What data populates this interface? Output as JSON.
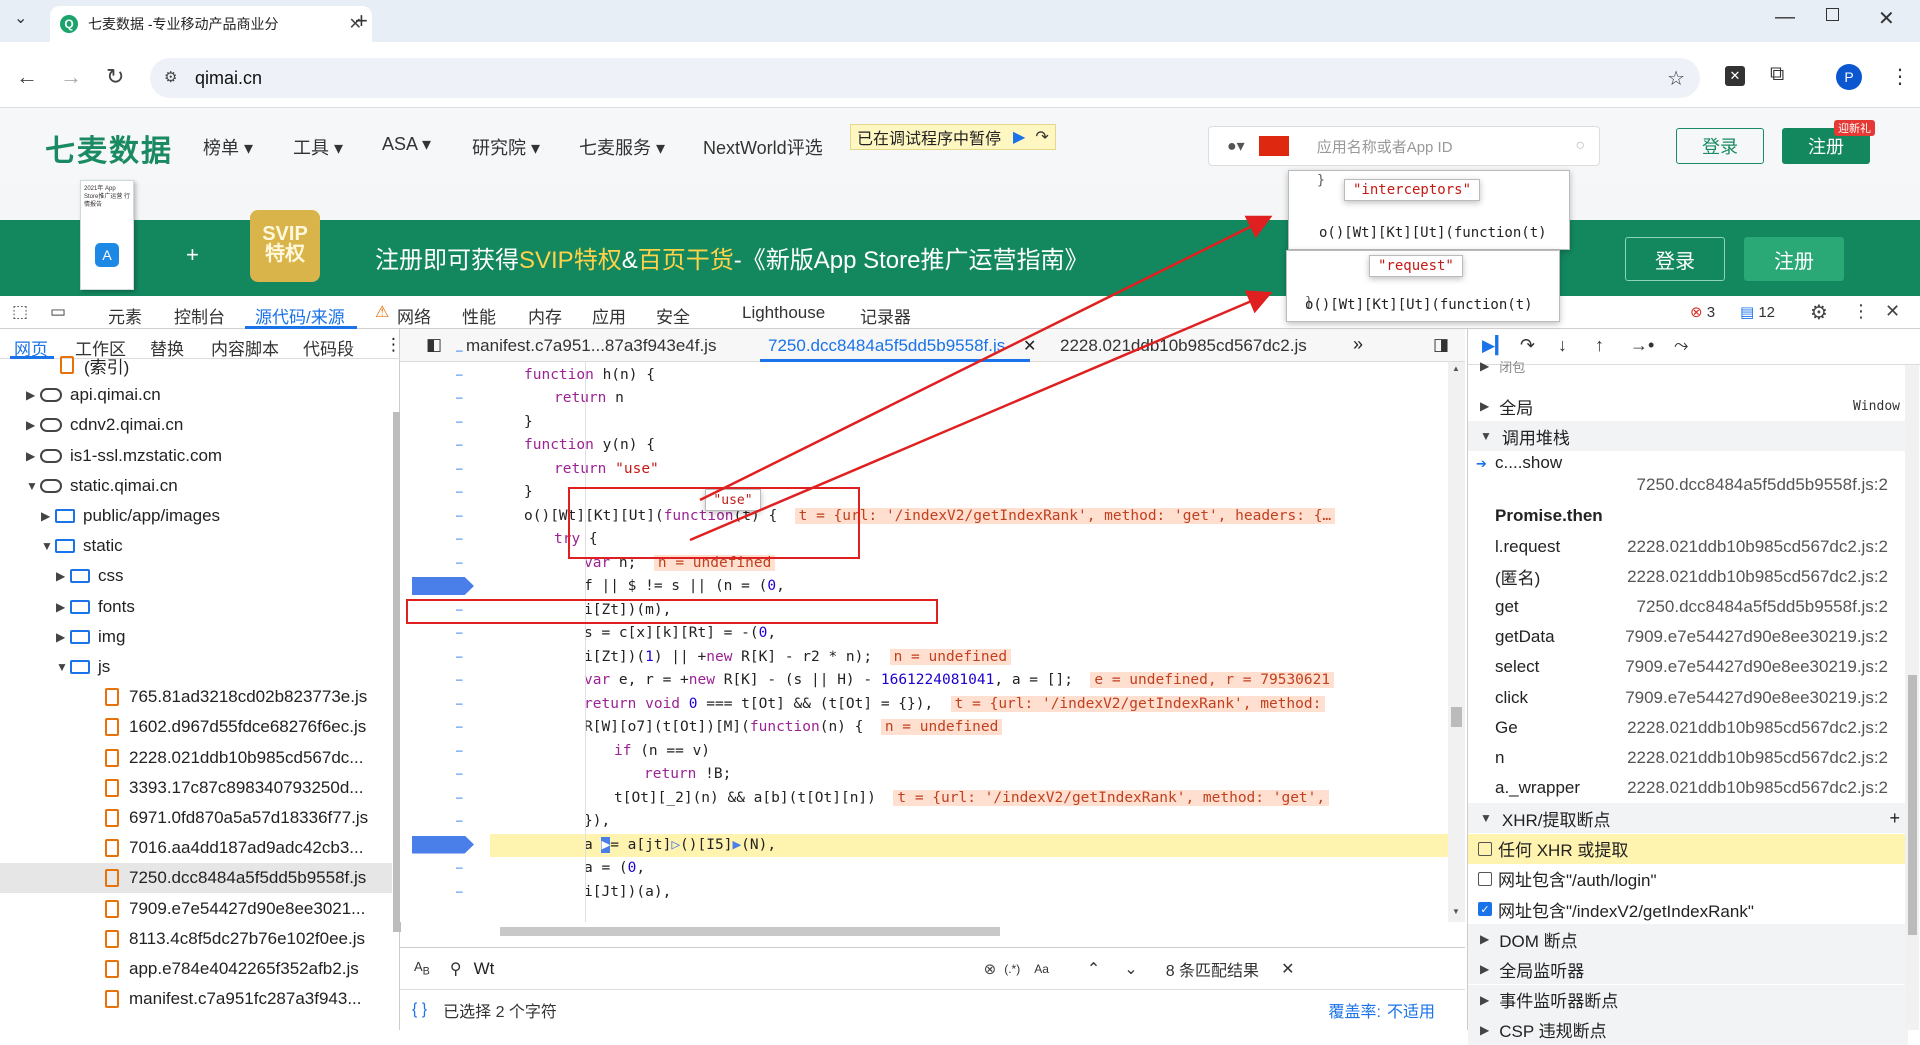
{
  "browser": {
    "tab_title": "七麦数据 -专业移动产品商业分",
    "url": "qimai.cn",
    "profile_initial": "P"
  },
  "site": {
    "logo": "七麦数据",
    "nav": [
      "榜单 ▾",
      "工具 ▾",
      "ASA ▾",
      "研究院 ▾",
      "七麦服务 ▾",
      "NextWorld评选"
    ],
    "paused_label": "已在调试程序中暂停",
    "search_placeholder": "应用名称或者App ID",
    "login": "登录",
    "register": "注册",
    "new_badge": "迎新礼",
    "banner_pre": "注册即可获得",
    "banner_svip": "SVIP特权",
    "banner_amp": "&",
    "banner_book": "百页干货",
    "banner_post": "-《新版App Store推广运营指南》",
    "banner_login": "登录",
    "banner_register": "注册",
    "book_title": "2021年 App Store推广运营 行情报告",
    "svip_badge": "SVIP 特权"
  },
  "devtools": {
    "tabs": [
      "元素",
      "控制台",
      "源代码/来源",
      "网络",
      "性能",
      "内存",
      "应用",
      "安全",
      "Lighthouse",
      "记录器"
    ],
    "errors": "3",
    "messages": "12",
    "left_tabs": [
      "网页",
      "工作区",
      "替换",
      "内容脚本",
      "代码段"
    ],
    "tree": [
      {
        "label": "(索引)",
        "indent": 60,
        "icon": "file"
      },
      {
        "label": "api.qimai.cn",
        "indent": 40,
        "icon": "cloud",
        "tri": "▶"
      },
      {
        "label": "cdnv2.qimai.cn",
        "indent": 40,
        "icon": "cloud",
        "tri": "▶"
      },
      {
        "label": "is1-ssl.mzstatic.com",
        "indent": 40,
        "icon": "cloud",
        "tri": "▶"
      },
      {
        "label": "static.qimai.cn",
        "indent": 40,
        "icon": "cloud",
        "tri": "▼"
      },
      {
        "label": "public/app/images",
        "indent": 55,
        "icon": "folder",
        "tri": "▶"
      },
      {
        "label": "static",
        "indent": 55,
        "icon": "folder",
        "tri": "▼"
      },
      {
        "label": "css",
        "indent": 70,
        "icon": "folder",
        "tri": "▶"
      },
      {
        "label": "fonts",
        "indent": 70,
        "icon": "folder",
        "tri": "▶"
      },
      {
        "label": "img",
        "indent": 70,
        "icon": "folder",
        "tri": "▶"
      },
      {
        "label": "js",
        "indent": 70,
        "icon": "folder",
        "tri": "▼"
      },
      {
        "label": "765.81ad3218cd02b823773e.js",
        "indent": 105,
        "icon": "file"
      },
      {
        "label": "1602.d967d55fdce68276f6ec.js",
        "indent": 105,
        "icon": "file"
      },
      {
        "label": "2228.021ddb10b985cd567dc...",
        "indent": 105,
        "icon": "file"
      },
      {
        "label": "3393.17c87c898340793250d...",
        "indent": 105,
        "icon": "file"
      },
      {
        "label": "6971.0fd870a5a57d18336f77.js",
        "indent": 105,
        "icon": "file"
      },
      {
        "label": "7016.aa4dd187ad9adc42cb3...",
        "indent": 105,
        "icon": "file"
      },
      {
        "label": "7250.dcc8484a5f5dd5b9558f.js",
        "indent": 105,
        "icon": "file",
        "selected": true
      },
      {
        "label": "7909.e7e54427d90e8ee3021...",
        "indent": 105,
        "icon": "file"
      },
      {
        "label": "8113.4c8f5dc27b76e102f0ee.js",
        "indent": 105,
        "icon": "file"
      },
      {
        "label": "app.e784e4042265f352afb2.js",
        "indent": 105,
        "icon": "file"
      },
      {
        "label": "manifest.c7a951fc287a3f943...",
        "indent": 105,
        "icon": "file"
      }
    ],
    "editor_tabs": [
      "manifest.c7a951...87a3f943e4f.js",
      "7250.dcc8484a5f5dd5b9558f.js",
      "2228.021ddb10b985cd567dc2.js"
    ],
    "search_query": "Wt",
    "search_regex": "(.*)",
    "search_case": "Aa",
    "search_results": "8 条匹配结果",
    "status_selected": "已选择 2 个字符",
    "coverage_label": "覆盖率:",
    "coverage_value": "不适用",
    "tooltip_use": "\"use\"",
    "popup1_str": "\"interceptors\"",
    "popup1_code": "o()[Wt][Kt][Ut](function(t)",
    "popup2_str": "\"request\"",
    "popup2_code": "o()[Wt][Kt][Ut](function(t)",
    "right": {
      "scope_partial": "闭包",
      "global_label": "全局",
      "global_value": "Window",
      "callstack_label": "调用堆栈",
      "frames": [
        {
          "fn": "c.<computed>.<computed>.<computed>.show",
          "loc": "7250.dcc8484a5f5dd5b9558f.js:2",
          "current": true
        },
        {
          "fn": "Promise.then",
          "loc": "",
          "async": true
        },
        {
          "fn": "l.request",
          "loc": "2228.021ddb10b985cd567dc2.js:2"
        },
        {
          "fn": "(匿名)",
          "loc": "2228.021ddb10b985cd567dc2.js:2"
        },
        {
          "fn": "get",
          "loc": "7250.dcc8484a5f5dd5b9558f.js:2"
        },
        {
          "fn": "getData",
          "loc": "7909.e7e54427d90e8ee30219.js:2"
        },
        {
          "fn": "select",
          "loc": "7909.e7e54427d90e8ee30219.js:2"
        },
        {
          "fn": "click",
          "loc": "7909.e7e54427d90e8ee30219.js:2"
        },
        {
          "fn": "Ge",
          "loc": "2228.021ddb10b985cd567dc2.js:2"
        },
        {
          "fn": "n",
          "loc": "2228.021ddb10b985cd567dc2.js:2"
        },
        {
          "fn": "a._wrapper",
          "loc": "2228.021ddb10b985cd567dc2.js:2"
        }
      ],
      "xhr_label": "XHR/提取断点",
      "xhr_items": [
        {
          "label": "任何 XHR 或提取",
          "checked": false,
          "highlight": true
        },
        {
          "label": "网址包含\"/auth/login\"",
          "checked": false
        },
        {
          "label": "网址包含\"/indexV2/getIndexRank\"",
          "checked": true
        }
      ],
      "sections": [
        "DOM 断点",
        "全局监听器",
        "事件监听器断点",
        "CSP 违规断点"
      ]
    }
  }
}
